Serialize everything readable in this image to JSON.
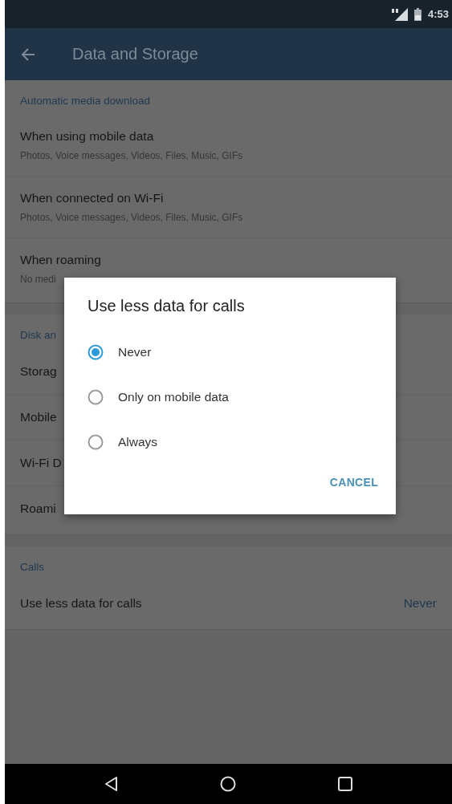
{
  "status_bar": {
    "time": "4:53"
  },
  "app_bar": {
    "title": "Data and Storage"
  },
  "sections": [
    {
      "header": "Automatic media download",
      "items": [
        {
          "title": "When using mobile data",
          "subtitle": "Photos, Voice messages, Videos, Files, Music, GIFs"
        },
        {
          "title": "When connected on Wi-Fi",
          "subtitle": "Photos, Voice messages, Videos, Files, Music, GIFs"
        },
        {
          "title": "When roaming",
          "subtitle": "No medi"
        }
      ]
    },
    {
      "header": "Disk an",
      "items": [
        {
          "title": "Storag"
        },
        {
          "title": "Mobile"
        },
        {
          "title": "Wi-Fi D"
        },
        {
          "title": "Roami"
        }
      ]
    },
    {
      "header": "Calls",
      "items": [
        {
          "title": "Use less data for calls",
          "value": "Never"
        }
      ]
    }
  ],
  "dialog": {
    "title": "Use less data for calls",
    "options": [
      {
        "label": "Never",
        "selected": true
      },
      {
        "label": "Only on mobile data",
        "selected": false
      },
      {
        "label": "Always",
        "selected": false
      }
    ],
    "buttons": [
      "CANCEL"
    ]
  }
}
